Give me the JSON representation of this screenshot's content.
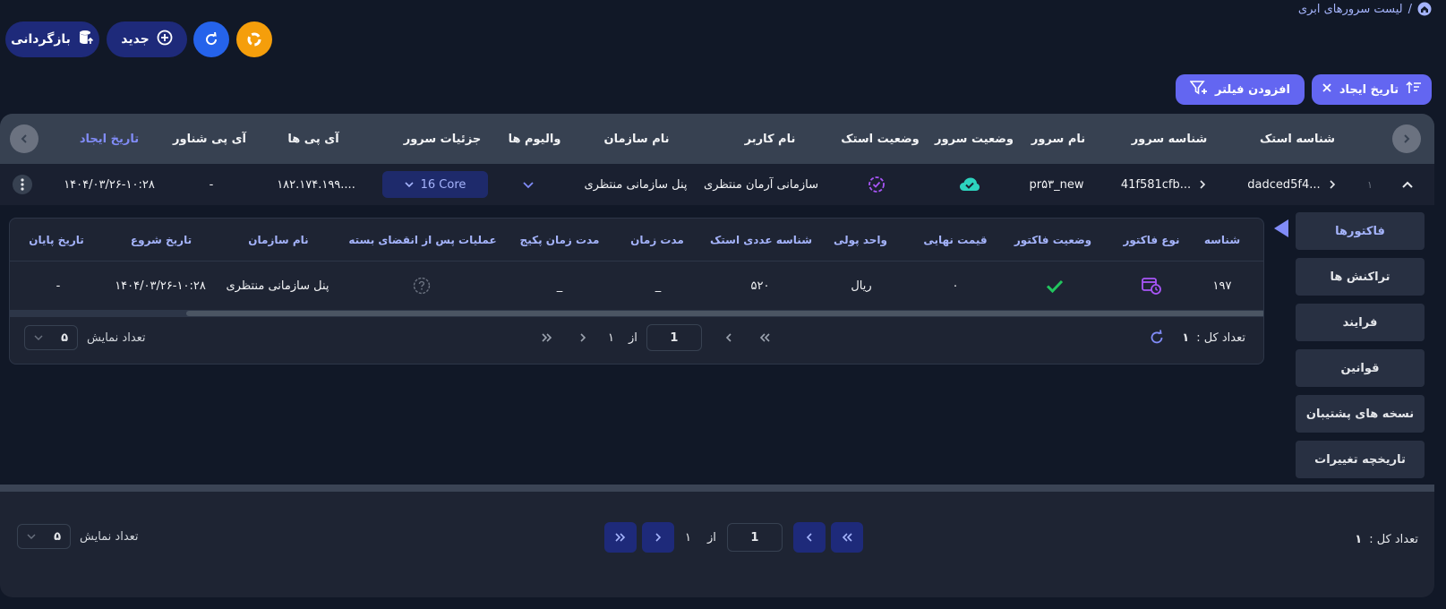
{
  "breadcrumb": {
    "label": "لیست سرورهای ابری",
    "separator": "/"
  },
  "actions": {
    "backup_label": "بازگردانی",
    "new_label": "جدید"
  },
  "filters": {
    "add_filter_label": "افزودن فیلتر",
    "sort_chip_label": "تاریخ ایجاد"
  },
  "table": {
    "headers": {
      "stack_id": "شناسه استک",
      "server_id": "شناسه سرور",
      "server_name": "نام سرور",
      "server_status": "وضعیت سرور",
      "stack_status": "وضعیت استک",
      "username": "نام کاربر",
      "org_name": "نام سازمان",
      "volumes": "والیوم ها",
      "server_details": "جزئیات سرور",
      "ips": "آی پی ها",
      "floating_ip": "آی پی شناور",
      "created_at": "تاریخ ایجاد"
    },
    "row": {
      "index": "۱",
      "stack_id": "dadced5f4...",
      "server_id": "41f581cfb...",
      "server_name": "pr۵۳_new",
      "username": "سازمانی آرمان منتظری",
      "org_name": "پنل سازمانی منتظری",
      "server_details": "16 Core",
      "ips": "۱۸۲.۱۷۴.۱۹۹....",
      "floating_ip": "-",
      "created_at": "۱۴۰۴/۰۳/۲۶-۱۰:۲۸"
    }
  },
  "side_tabs": [
    "فاکتورها",
    "تراکنش ها",
    "فرایند",
    "قوانین",
    "نسخه های پشتیبان",
    "تاریخچه تغییرات"
  ],
  "invoice_table": {
    "headers": {
      "id": "شناسه",
      "type": "نوع فاکتور",
      "status": "وضعیت فاکتور",
      "final_price": "قیمت نهایی",
      "currency": "واحد پولی",
      "stack_numeric_id": "شناسه عددی استک",
      "duration": "مدت زمان",
      "package_duration": "مدت زمان پکیج",
      "after_expiry": "عملیات پس از انقضای بسته",
      "org_name": "نام سازمان",
      "start_date": "تاریخ شروع",
      "end_date": "تاریخ پایان"
    },
    "row": {
      "id": "۱۹۷",
      "final_price": "۰",
      "currency": "ریال",
      "stack_numeric_id": "۵۲۰",
      "duration": "_",
      "package_duration": "_",
      "org_name": "پنل سازمانی منتظری",
      "start_date": "۱۴۰۴/۰۳/۲۶-۱۰:۲۸",
      "end_date": "-"
    },
    "pager": {
      "total_label": "تعداد کل :",
      "total": "۱",
      "of_label": "از",
      "total_pages": "۱",
      "current_page": "1",
      "page_size_label": "تعداد نمایش",
      "page_size": "۵"
    }
  },
  "main_pager": {
    "total_label": "تعداد کل :",
    "total": "۱",
    "of_label": "از",
    "total_pages": "۱",
    "current_page": "1",
    "page_size_label": "تعداد نمایش",
    "page_size": "۵"
  },
  "colors": {
    "accent": "#6366f1",
    "success": "#22c55e",
    "teal": "#2dd4bf",
    "purple": "#a855f7",
    "orange": "#f59e0b",
    "blue": "#2563eb"
  }
}
